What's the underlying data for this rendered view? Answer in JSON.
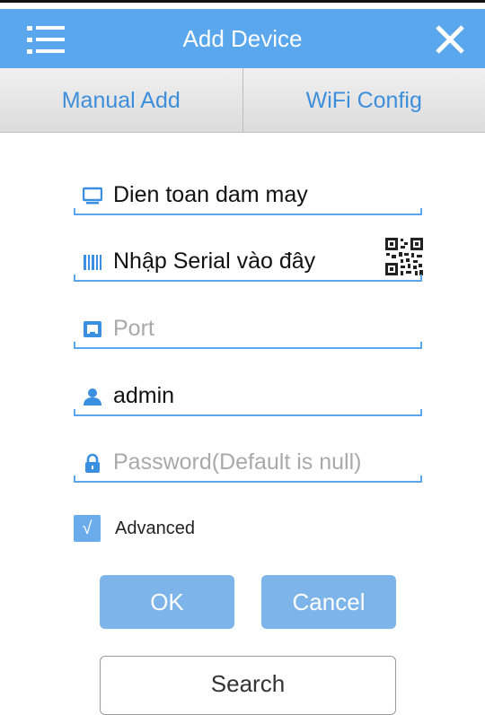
{
  "header": {
    "title": "Add Device",
    "menu_icon": "menu-icon",
    "close_icon": "close-icon"
  },
  "tabs": [
    {
      "label": "Manual Add"
    },
    {
      "label": "WiFi Config"
    }
  ],
  "form": {
    "device_name": {
      "value": "Dien toan dam may",
      "placeholder": "",
      "icon": "monitor-icon"
    },
    "serial": {
      "value": "Nhập Serial vào đây",
      "placeholder": "",
      "icon": "barcode-icon",
      "qr_icon": "qr-code-icon"
    },
    "port": {
      "value": "",
      "placeholder": "Port",
      "icon": "port-icon"
    },
    "username": {
      "value": "admin",
      "placeholder": "",
      "icon": "user-icon"
    },
    "password": {
      "value": "",
      "placeholder": "Password(Default is null)",
      "icon": "lock-icon"
    },
    "advanced": {
      "label": "Advanced",
      "checked": true,
      "check_glyph": "√"
    }
  },
  "buttons": {
    "ok": "OK",
    "cancel": "Cancel",
    "search": "Search"
  },
  "colors": {
    "accent": "#5aa7ee",
    "tab_text": "#3d8edb",
    "button_blue": "#7db4ea",
    "icon_blue": "#3b8fe0"
  }
}
